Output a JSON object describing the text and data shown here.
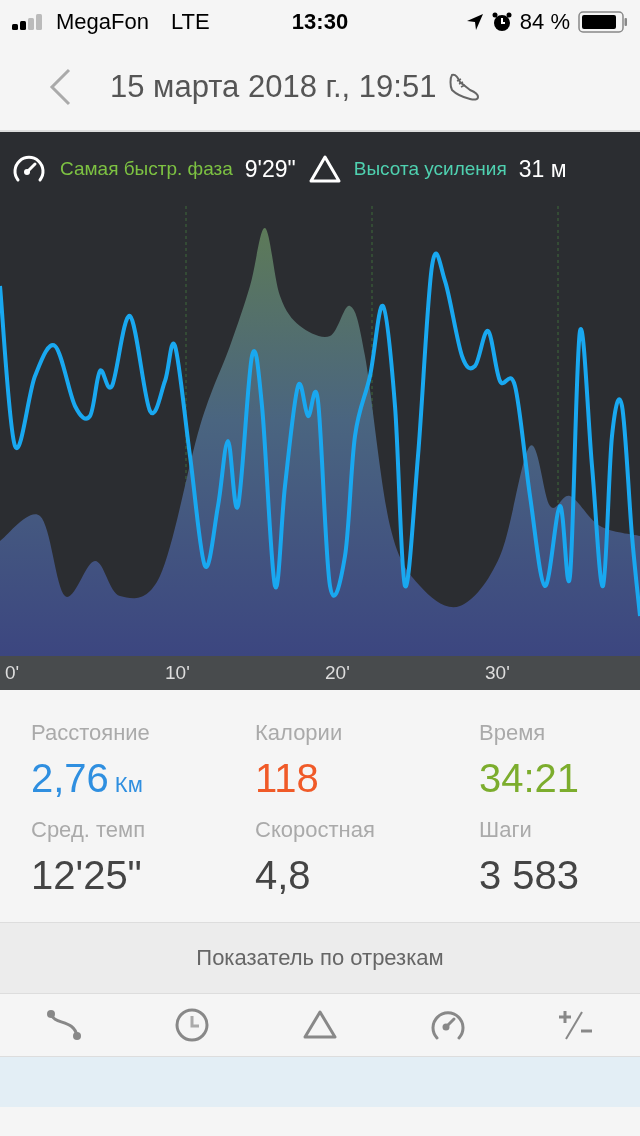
{
  "status_bar": {
    "carrier": "MegaFon",
    "network": "LTE",
    "time": "13:30",
    "battery": "84 %"
  },
  "header": {
    "title": "15 марта 2018 г., 19:51"
  },
  "chart_summary": [
    {
      "kind": "speed",
      "label": "Самая быстр. фаза",
      "value": "9'29\"",
      "color": "#7dc242"
    },
    {
      "kind": "elevation",
      "label": "Высота усиления",
      "value": "31 м",
      "color": "#4fd1b0"
    }
  ],
  "x_axis_labels": [
    "0'",
    "10'",
    "20'",
    "30'"
  ],
  "stats": [
    {
      "label": "Расстояние",
      "value": "2,76",
      "unit": "Км",
      "color": "#2f8fe0"
    },
    {
      "label": "Калории",
      "value": "118",
      "color": "#f05a28"
    },
    {
      "label": "Время",
      "value": "34:21",
      "color": "#7cad2d"
    },
    {
      "label": "Сред. темп",
      "value": "12'25\"",
      "color": "#444444"
    },
    {
      "label": "Скоростная",
      "value": "4,8",
      "color": "#444444"
    },
    {
      "label": "Шаги",
      "value": "3 583",
      "color": "#444444"
    }
  ],
  "segments": {
    "title": "Показатель по отрезкам",
    "tabs": [
      {
        "kind": "route"
      },
      {
        "kind": "time"
      },
      {
        "kind": "elevation"
      },
      {
        "kind": "speed"
      },
      {
        "kind": "plusminus"
      }
    ]
  }
}
